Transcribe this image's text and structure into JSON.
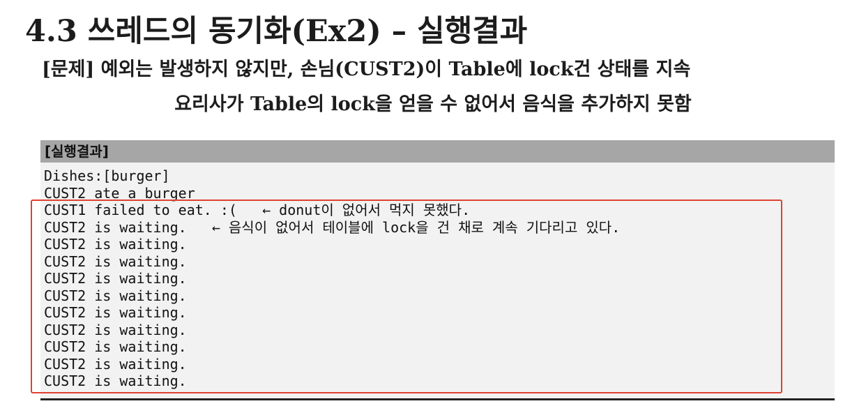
{
  "slide": {
    "title": "4.3 쓰레드의 동기화(Ex2) – 실행결과",
    "problem_line1": "[문제] 예외는 발생하지 않지만, 손님(CUST2)이 Table에 lock건 상태를 지속",
    "problem_line2": "요리사가 Table의 lock을 얻을 수 없어서 음식을 추가하지 못함"
  },
  "result": {
    "header": "[실행결과]",
    "lines": [
      "Dishes:[burger]",
      "CUST2 ate a burger",
      "CUST1 failed to eat. :(   ← donut이 없어서 먹지 못했다.",
      "CUST2 is waiting.   ← 음식이 없어서 테이블에 lock을 건 채로 계속 기다리고 있다.",
      "CUST2 is waiting.",
      "CUST2 is waiting.",
      "CUST2 is waiting.",
      "CUST2 is waiting.",
      "CUST2 is waiting.",
      "CUST2 is waiting.",
      "CUST2 is waiting.",
      "CUST2 is waiting.",
      "CUST2 is waiting."
    ]
  },
  "colors": {
    "header_bg": "#a6a6a6",
    "box_bg": "#f2f2f2",
    "highlight_border": "#e0412f",
    "text": "#111111"
  }
}
